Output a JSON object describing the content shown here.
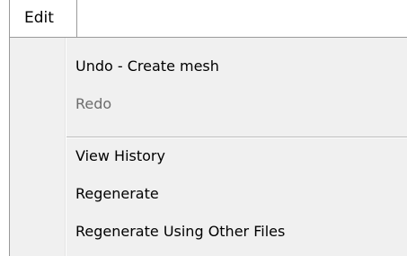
{
  "menubar": {
    "title": "Edit"
  },
  "menu": {
    "items": [
      {
        "label": "Undo - Create mesh",
        "enabled": true
      },
      {
        "label": "Redo",
        "enabled": false
      },
      {
        "label": "View History",
        "enabled": true
      },
      {
        "label": "Regenerate",
        "enabled": true
      },
      {
        "label": "Regenerate Using Other Files",
        "enabled": true
      }
    ]
  }
}
